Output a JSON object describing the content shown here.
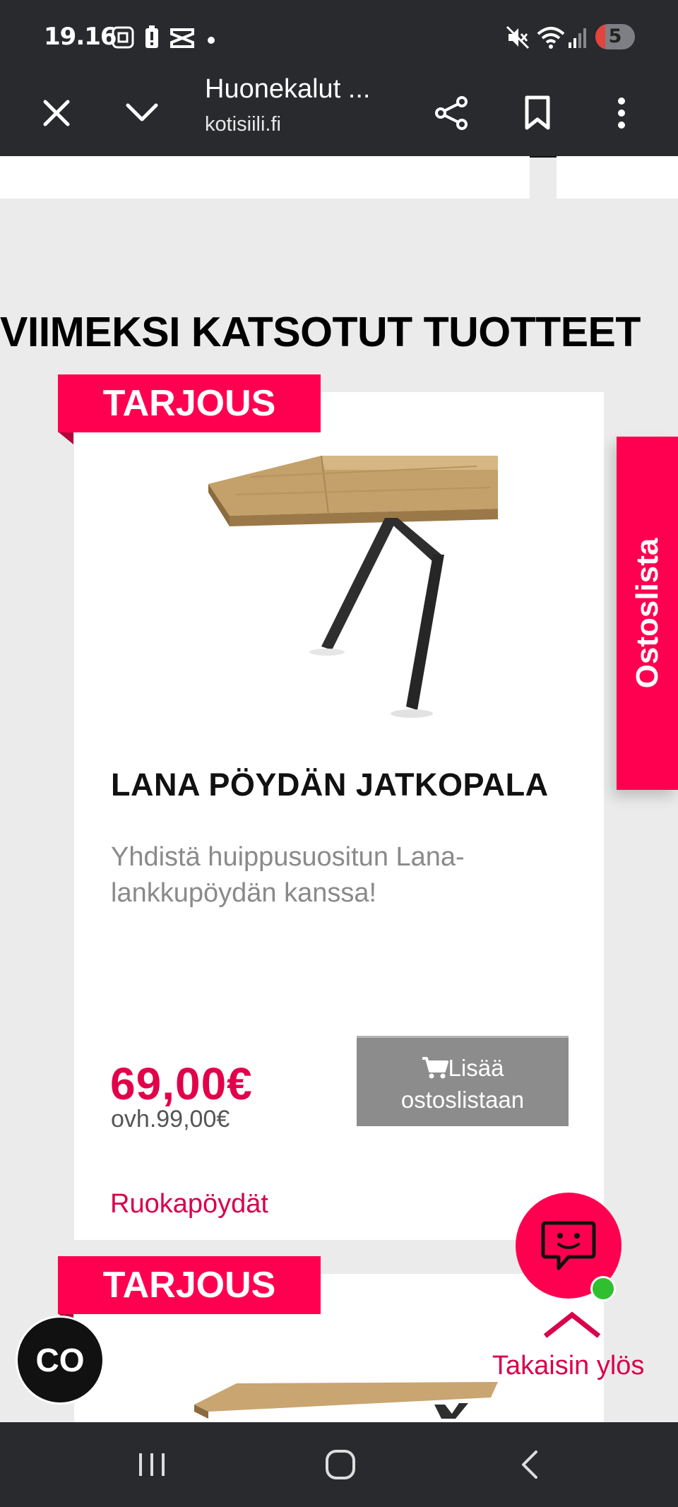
{
  "status_bar": {
    "time": "19.16",
    "notification_count": "5"
  },
  "toolbar": {
    "page_title": "Huonekalut ...",
    "url": "kotisiili.fi"
  },
  "section": {
    "title": "VIIMEKSI KATSOTUT TUOTTEET"
  },
  "products": [
    {
      "badge": "TARJOUS",
      "name": "LANA PÖYDÄN JATKOPALA",
      "description": "Yhdistä huippusuositun Lana-lankkupöydän kanssa!",
      "price": "69,00€",
      "old_price": "ovh.99,00€",
      "add_button": "Lisää ostoslistaan",
      "category": "Ruokapöydät"
    },
    {
      "badge": "TARJOUS"
    }
  ],
  "side_tab": {
    "label": "Ostoslista"
  },
  "back_to_top": {
    "label": "Takaisin ylös"
  },
  "floating": {
    "co_label": "CO"
  },
  "icons": {
    "close": "close-icon",
    "collapse": "chevron-down-icon",
    "share": "share-icon",
    "bookmark": "bookmark-icon",
    "menu": "more-vert-icon",
    "cart": "cart-icon",
    "chat": "chat-icon"
  },
  "colors": {
    "brand_pink": "#ff0050",
    "link_pink": "#d9004c",
    "button_gray": "#8c8c8c",
    "chrome_dark": "#282a2e"
  }
}
